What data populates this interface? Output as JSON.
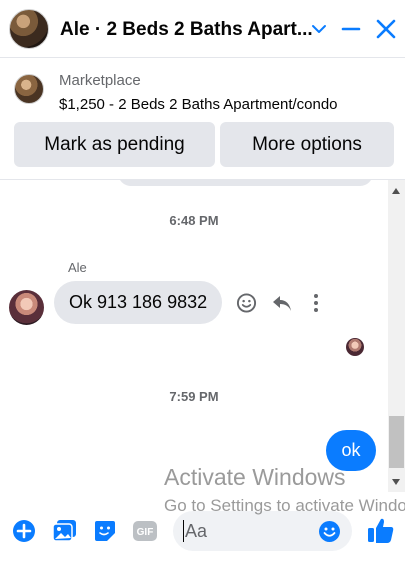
{
  "header": {
    "title": "Ale · 2 Beds 2 Baths Apart...",
    "accent_color": "#0a7cff",
    "icons": [
      "chevron-down-icon",
      "minimize-icon",
      "close-icon"
    ]
  },
  "marketplace": {
    "label": "Marketplace",
    "listing": "$1,250 - 2 Beds 2 Baths Apartment/condo",
    "mark_pending_label": "Mark as pending",
    "more_options_label": "More options"
  },
  "messages": {
    "timestamp_1": "6:48 PM",
    "sender_name": "Ale",
    "incoming_text": "Ok 913 186 9832",
    "timestamp_2": "7:59 PM",
    "outgoing_text": "ok",
    "outgoing_color": "#0a7cff",
    "incoming_bubble_color": "#e4e6eb"
  },
  "composer": {
    "placeholder": "Aa",
    "icons": [
      "plus-icon",
      "photo-icon",
      "sticker-icon",
      "gif-icon",
      "emoji-icon",
      "like-icon"
    ]
  },
  "watermark": {
    "title": "Activate Windows",
    "subtitle": "Go to Settings to activate Windows."
  }
}
